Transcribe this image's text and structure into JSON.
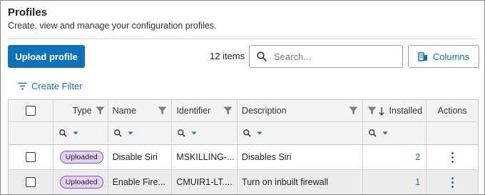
{
  "header": {
    "title": "Profiles",
    "subtitle": "Create, view and manage your configuration profiles."
  },
  "toolbar": {
    "upload_label": "Upload profile",
    "item_count": "12 items",
    "search_placeholder": "Search...",
    "columns_label": "Columns",
    "create_filter_label": "Create Filter"
  },
  "table": {
    "columns": [
      "Type",
      "Name",
      "Identifier",
      "Description",
      "Installed",
      "Actions"
    ],
    "rows": [
      {
        "type": "Uploaded",
        "name": "Disable Siri",
        "identifier": "MSKILLING-...",
        "description": "Disables Siri",
        "installed": "2"
      },
      {
        "type": "Uploaded",
        "name": "Enable Fire...",
        "identifier": "CMUIR1-LT....",
        "description": "Turn on inbuilt firewall",
        "installed": "1"
      }
    ]
  },
  "colors": {
    "accent": "#0f72b8",
    "badge_bg": "#e6cff5",
    "badge_border": "#8a4fb8"
  },
  "icons": [
    "search-icon",
    "columns-icon",
    "filter-lines-icon",
    "funnel-icon",
    "sort-down-arrow-icon",
    "chevron-down-icon",
    "kebab-menu-icon"
  ]
}
